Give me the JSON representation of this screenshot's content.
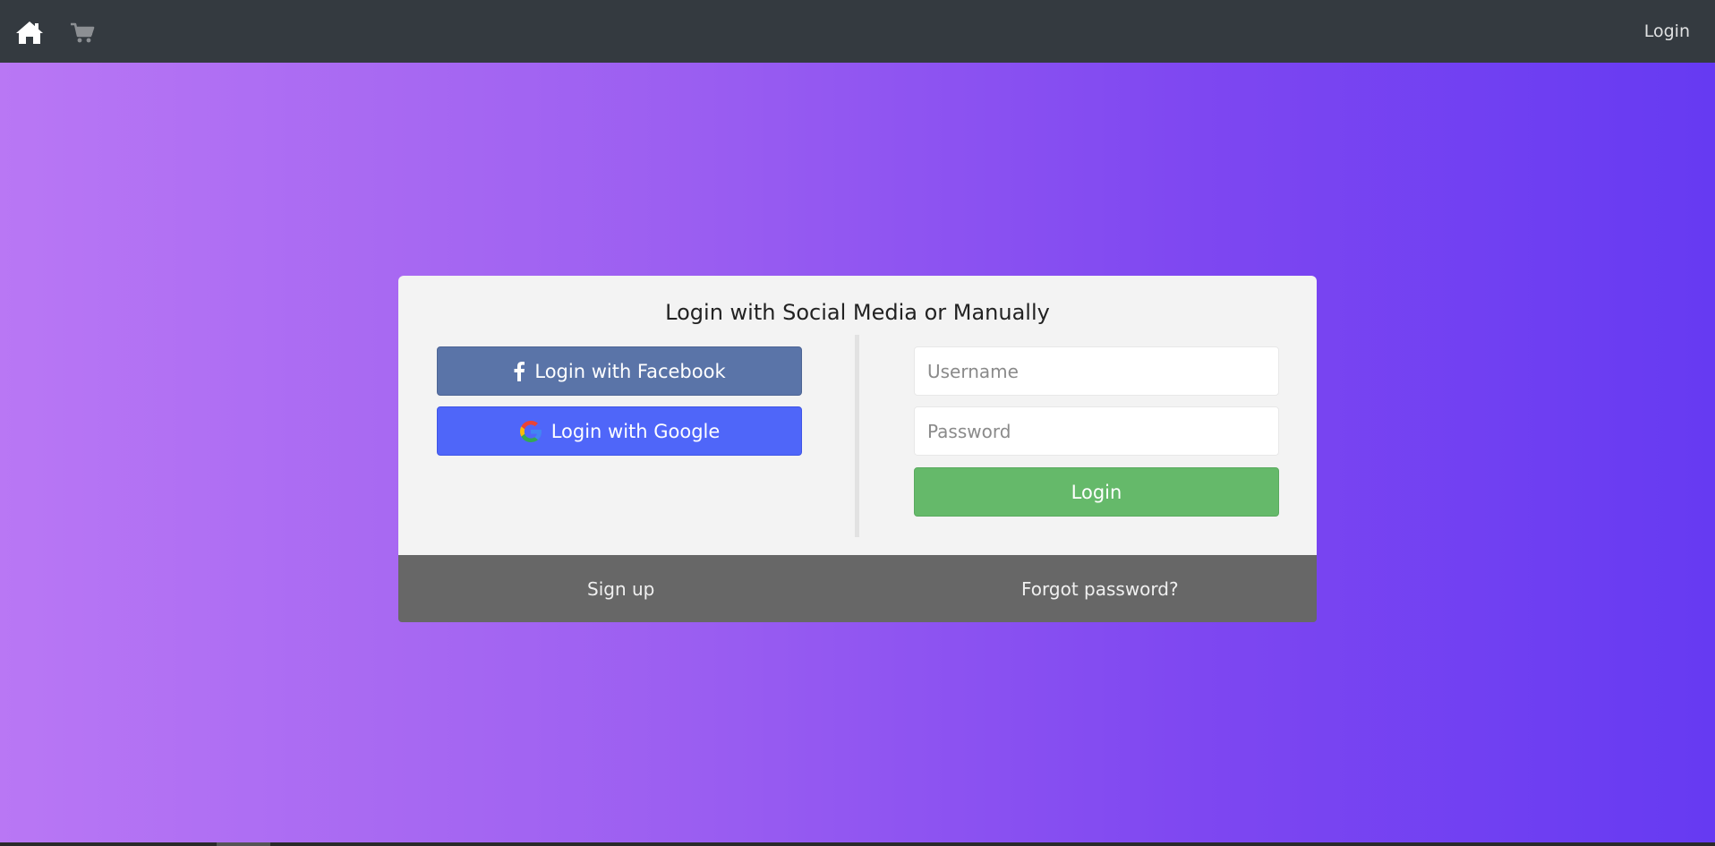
{
  "navbar": {
    "home_icon": "home-icon",
    "cart_icon": "cart-icon",
    "login_label": "Login"
  },
  "card": {
    "title": "Login with Social Media or Manually",
    "facebook_label": "Login with Facebook",
    "google_label": "Login with Google",
    "username_placeholder": "Username",
    "username_value": "",
    "password_placeholder": "Password",
    "password_value": "",
    "login_label": "Login"
  },
  "footer": {
    "signup_label": "Sign up",
    "forgot_label": "Forgot password?"
  },
  "colors": {
    "navbar": "#343a40",
    "facebook": "#5a74a8",
    "google": "#4f66f9",
    "login": "#65b96a",
    "footer": "#676767",
    "gradient_start": "#b977f4",
    "gradient_end": "#663af2"
  }
}
